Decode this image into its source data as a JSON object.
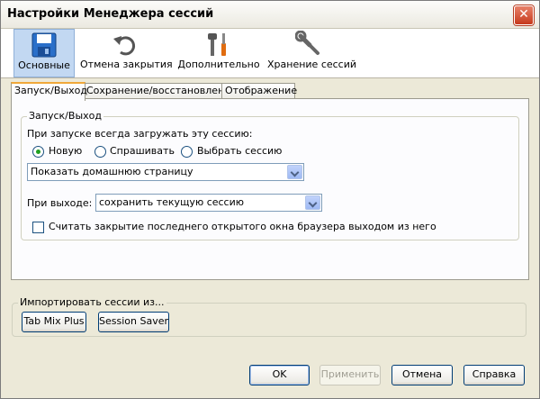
{
  "window": {
    "title": "Настройки Менеджера сессий"
  },
  "toolbar": {
    "items": [
      {
        "label": "Основные",
        "icon": "floppy-disk-icon",
        "active": true
      },
      {
        "label": "Отмена закрытия",
        "icon": "undo-arrow-icon",
        "active": false
      },
      {
        "label": "Дополнительно",
        "icon": "tools-icon",
        "active": false
      },
      {
        "label": "Хранение сессий",
        "icon": "wrench-icon",
        "active": false
      }
    ]
  },
  "tabs": [
    {
      "label": "Запуск/Выход",
      "active": true
    },
    {
      "label": "Сохранение/восстановление",
      "active": false
    },
    {
      "label": "Отображение",
      "active": false
    }
  ],
  "startup": {
    "group_label": "Запуск/Выход",
    "on_start_label": "При запуске всегда загружать эту сессию:",
    "radio_new": "Новую",
    "radio_ask": "Спрашивать",
    "radio_choose": "Выбрать сессию",
    "selected_radio": "new",
    "start_select_value": "Показать домашнюю страницу",
    "on_exit_label": "При выходе:",
    "exit_select_value": "сохранить текущую сессию",
    "checkbox_label": "Считать закрытие последнего открытого окна браузера выходом из него",
    "checkbox_checked": false
  },
  "import": {
    "group_label": "Импортировать сессии из...",
    "btn_tabmix": "Tab Mix Plus",
    "btn_session_saver": "Session Saver"
  },
  "buttons": {
    "ok": "OK",
    "apply": "Применить",
    "cancel": "Отмена",
    "help": "Справка"
  },
  "colors": {
    "active_tab_accent": "#f0a83a",
    "toolbar_selected": "#c2d8f2",
    "close_button": "#c6391c"
  }
}
